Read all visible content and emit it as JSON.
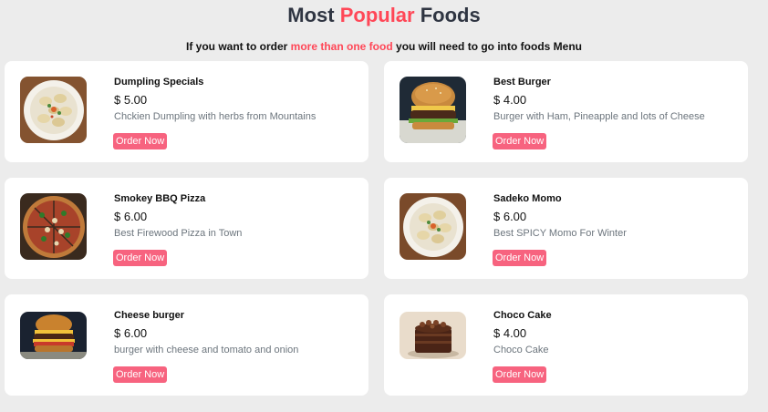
{
  "header": {
    "title_part1": "Most",
    "title_accent": "Popular",
    "title_part2": "Foods",
    "subtitle_part1": "If you want to order",
    "subtitle_accent": "more than one food",
    "subtitle_part2": "you will need to go into foods Menu"
  },
  "colors": {
    "accent": "#ff4757",
    "button": "#f7637f",
    "title": "#2f3542",
    "background": "#ececec"
  },
  "foods": [
    {
      "name": "Dumpling Specials",
      "price": "$ 5.00",
      "description": "Chckien Dumpling with herbs from Mountains",
      "button": "Order Now",
      "image": "dumpling-plate-image"
    },
    {
      "name": "Best Burger",
      "price": "$ 4.00",
      "description": "Burger with Ham, Pineapple and lots of Cheese",
      "button": "Order Now",
      "image": "burger-image"
    },
    {
      "name": "Smokey BBQ Pizza",
      "price": "$ 6.00",
      "description": "Best Firewood Pizza in Town",
      "button": "Order Now",
      "image": "pizza-image"
    },
    {
      "name": "Sadeko Momo",
      "price": "$ 6.00",
      "description": "Best SPICY Momo For Winter",
      "button": "Order Now",
      "image": "momo-plate-image"
    },
    {
      "name": "Cheese burger",
      "price": "$ 6.00",
      "description": "burger with cheese and tomato and onion",
      "button": "Order Now",
      "image": "cheese-burger-image"
    },
    {
      "name": "Choco Cake",
      "price": "$ 4.00",
      "description": "Choco Cake",
      "button": "Order Now",
      "image": "chocolate-cake-image"
    }
  ]
}
